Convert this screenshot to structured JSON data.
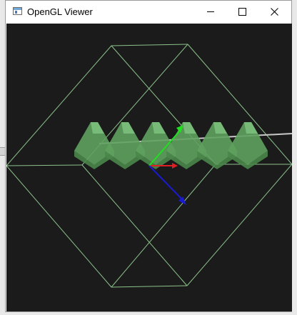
{
  "window": {
    "title": "OpenGL Viewer",
    "controls": [
      "minimize",
      "maximize",
      "close"
    ]
  },
  "scene": {
    "background_color": "#1b1b1b",
    "wireframe_color": "#9fe09f",
    "block_color": "#5fa15f",
    "block_count": 6,
    "axis_x_color": "#e02020",
    "axis_y_color": "#20e020",
    "axis_z_color": "#1a1ad0",
    "line_color": "#c8c8c8"
  }
}
